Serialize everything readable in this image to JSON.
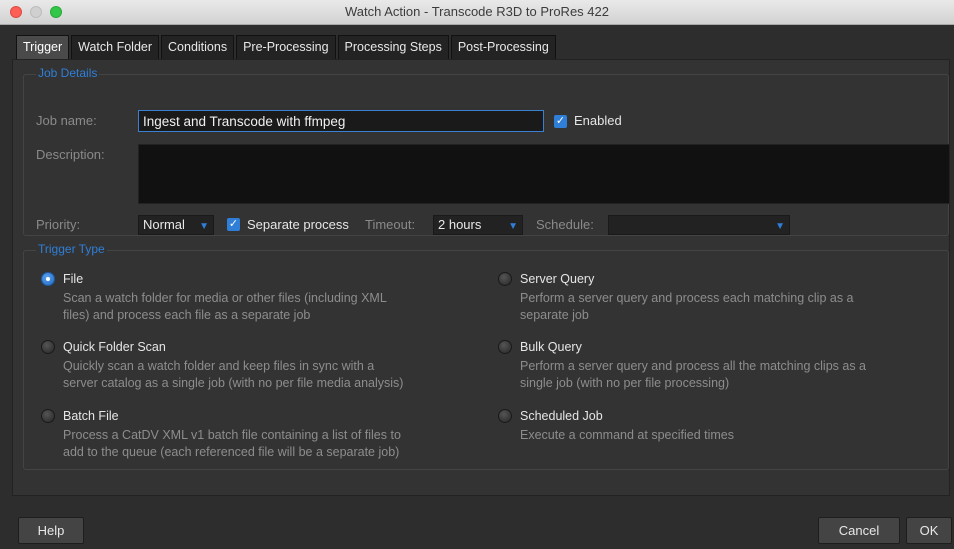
{
  "window": {
    "title": "Watch Action - Transcode R3D to ProRes 422"
  },
  "tabs": [
    {
      "label": "Trigger",
      "active": true
    },
    {
      "label": "Watch Folder"
    },
    {
      "label": "Conditions"
    },
    {
      "label": "Pre-Processing"
    },
    {
      "label": "Processing Steps"
    },
    {
      "label": "Post-Processing"
    }
  ],
  "job_details": {
    "title": "Job Details",
    "job_name_label": "Job name:",
    "job_name_value": "Ingest and Transcode with ffmpeg",
    "enabled_label": "Enabled",
    "enabled": true,
    "description_label": "Description:",
    "description_value": "",
    "priority_label": "Priority:",
    "priority_value": "Normal",
    "separate_process_label": "Separate process",
    "separate_process": true,
    "timeout_label": "Timeout:",
    "timeout_value": "2 hours",
    "schedule_label": "Schedule:",
    "schedule_value": ""
  },
  "trigger_type": {
    "title": "Trigger Type",
    "options": [
      {
        "label": "File",
        "selected": true,
        "desc": [
          "Scan a watch folder for media or other files (including XML",
          "files) and process each file as a separate job"
        ]
      },
      {
        "label": "Quick Folder Scan",
        "selected": false,
        "desc": [
          "Quickly scan a watch folder and keep files in sync with a",
          "server catalog as a single job (with no per file media analysis)"
        ]
      },
      {
        "label": "Batch File",
        "selected": false,
        "desc": [
          "Process a CatDV XML v1 batch file containing a list of files to",
          "add to the queue (each referenced file will be a separate job)"
        ]
      },
      {
        "label": "Server Query",
        "selected": false,
        "desc": [
          "Perform a server query and process each matching clip as a",
          "separate job"
        ]
      },
      {
        "label": "Bulk Query",
        "selected": false,
        "desc": [
          "Perform a server query and process all the matching clips as a",
          "single job (with no per file processing)"
        ]
      },
      {
        "label": "Scheduled Job",
        "selected": false,
        "desc": [
          "Execute a command at specified times"
        ]
      }
    ]
  },
  "footer": {
    "help_label": "Help",
    "cancel_label": "Cancel",
    "ok_label": "OK"
  },
  "colors": {
    "accent": "#2f7ed8",
    "background": "#2d2d2d"
  },
  "icons": {
    "check": "checkmark-icon",
    "dropdown": "chevron-down-icon"
  }
}
